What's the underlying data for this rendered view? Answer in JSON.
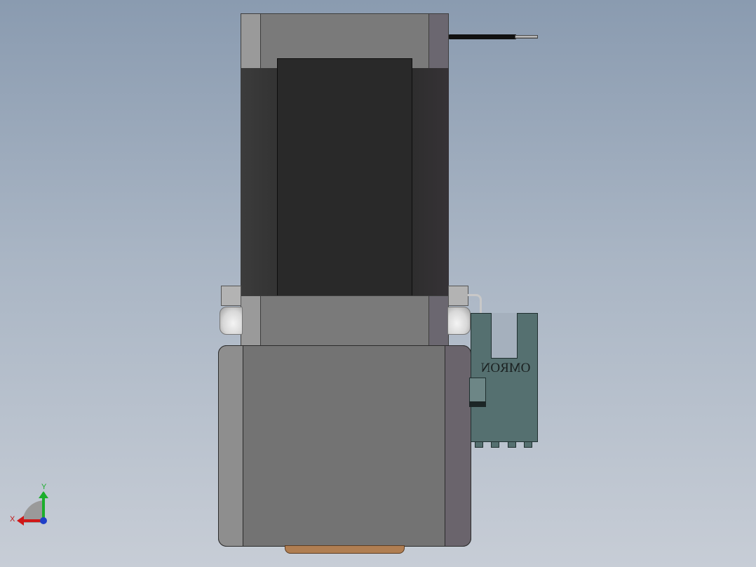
{
  "viewport": {
    "background_colors": [
      "#8a9bb0",
      "#c7cdd6"
    ]
  },
  "model": {
    "sensor_brand": "OMRON",
    "colors": {
      "motor_plate": "#7a7a7a",
      "motor_band": "#2f2f2f",
      "gearbox": "#737373",
      "output_flange": "#b07e52",
      "sensor": "#557070"
    }
  },
  "triad": {
    "x_label": "X",
    "y_label": "Y",
    "x_color": "#d01818",
    "y_color": "#1cae2c",
    "z_color": "#1f3fc8"
  }
}
